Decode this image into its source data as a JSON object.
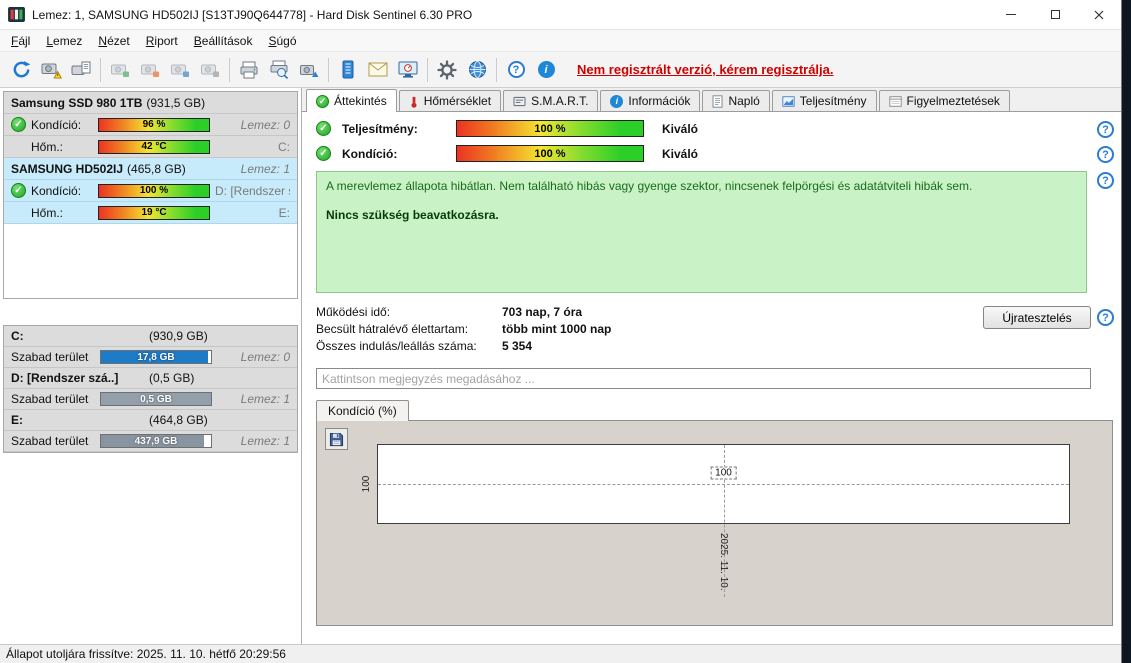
{
  "window": {
    "title": "Lemez: 1, SAMSUNG HD502IJ [S13TJ90Q644778]  -  Hard Disk Sentinel 6.30 PRO"
  },
  "menu": {
    "items": [
      {
        "label": "Fájl"
      },
      {
        "label": "Lemez"
      },
      {
        "label": "Nézet"
      },
      {
        "label": "Riport"
      },
      {
        "label": "Beállítások"
      },
      {
        "label": "Súgó"
      }
    ]
  },
  "toolbar": {
    "notice": "Nem regisztrált verzió, kérem regisztrálja."
  },
  "sidebar": {
    "disks": [
      {
        "name": "Samsung SSD 980 1TB",
        "size": "(931,5 GB)",
        "header_right": "",
        "health_label": "Kondíció:",
        "health_value": "96 %",
        "row1_right": "Lemez: 0",
        "temp_label": "Hőm.:",
        "temp_value": "42 °C",
        "row2_right": "C:",
        "health_pct": 96,
        "temp_c": 42
      },
      {
        "name": "SAMSUNG HD502IJ",
        "size": "(465,8 GB)",
        "header_right": "Lemez: 1",
        "health_label": "Kondíció:",
        "health_value": "100 %",
        "row1_right": "D: [Rendszer számá",
        "temp_label": "Hőm.:",
        "temp_value": "19 °C",
        "row2_right": "E:",
        "health_pct": 100,
        "temp_c": 19
      }
    ],
    "partitions": [
      {
        "name": "C:",
        "size": "(930,9 GB)",
        "free_label": "Szabad terület",
        "free_value": "17,8 GB",
        "disk_no": "Lemez: 0",
        "fill_pct": 97,
        "bar_color": "#1e7bc8"
      },
      {
        "name": "D: [Rendszer szá..]",
        "size": "(0,5 GB)",
        "free_label": "Szabad terület",
        "free_value": "0,5 GB",
        "disk_no": "Lemez: 1",
        "fill_pct": 100,
        "bar_color": "#93a0ac"
      },
      {
        "name": "E:",
        "size": "(464,8 GB)",
        "free_label": "Szabad terület",
        "free_value": "437,9 GB",
        "disk_no": "Lemez: 1",
        "fill_pct": 94,
        "bar_color": "#8895a1"
      }
    ]
  },
  "tabs": {
    "items": [
      {
        "label": "Áttekintés"
      },
      {
        "label": "Hőmérséklet"
      },
      {
        "label": "S.M.A.R.T."
      },
      {
        "label": "Információk"
      },
      {
        "label": "Napló"
      },
      {
        "label": "Teljesítmény"
      },
      {
        "label": "Figyelmeztetések"
      }
    ]
  },
  "overview": {
    "performance": {
      "label": "Teljesítmény:",
      "value": "100 %",
      "rating": "Kiváló"
    },
    "health": {
      "label": "Kondíció:",
      "value": "100 %",
      "rating": "Kiváló"
    },
    "status_text": "A merevlemez állapota hibátlan. Nem található hibás vagy gyenge szektor, nincsenek felpörgési és adatátviteli hibák sem.",
    "status_advice": "Nincs szükség beavatkozásra.",
    "stats": [
      {
        "label": "Működési idő:",
        "value": "703 nap, 7 óra"
      },
      {
        "label": "Becsült hátralévő élettartam:",
        "value": "több mint 1000 nap"
      },
      {
        "label": "Összes indulás/leállás száma:",
        "value": "5 354"
      }
    ],
    "retest_button": "Újratesztelés",
    "comment_placeholder": "Kattintson megjegyzés megadásához ...",
    "chart_tab_label": "Kondíció  (%)"
  },
  "chart_data": {
    "type": "line",
    "title": "Kondíció (%)",
    "x": [
      "2025. 11. 10."
    ],
    "values": [
      100
    ],
    "series": [
      {
        "name": "Kondíció",
        "values": [
          100
        ]
      }
    ],
    "y_tick": "100",
    "point_label": "100",
    "grid": "dashed-crosshair",
    "legend_position": "none"
  },
  "statusbar": {
    "text": "Állapot utoljára frissítve: 2025. 11. 10. hétfő 20:29:56"
  }
}
